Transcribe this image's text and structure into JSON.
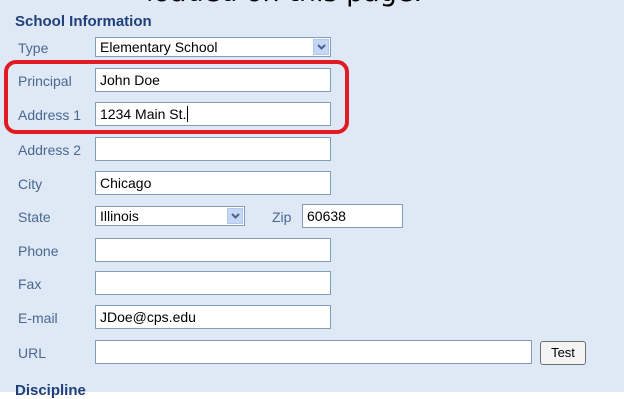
{
  "caption": "loaded on this page.",
  "section": {
    "title": "School Information",
    "next_title": "Discipline"
  },
  "fields": {
    "type": {
      "label": "Type",
      "value": "Elementary School"
    },
    "principal": {
      "label": "Principal",
      "value": "John Doe"
    },
    "address1": {
      "label": "Address 1",
      "value": "1234 Main St."
    },
    "address2": {
      "label": "Address 2",
      "value": ""
    },
    "city": {
      "label": "City",
      "value": "Chicago"
    },
    "state": {
      "label": "State",
      "value": "Illinois"
    },
    "zip": {
      "label": "Zip",
      "value": "60638"
    },
    "phone": {
      "label": "Phone",
      "value": ""
    },
    "fax": {
      "label": "Fax",
      "value": ""
    },
    "email": {
      "label": "E-mail",
      "value": "JDoe@cps.edu"
    },
    "url": {
      "label": "URL",
      "value": ""
    }
  },
  "buttons": {
    "test": "Test"
  },
  "colors": {
    "panel": "#dfe8f5",
    "label": "#4a6892",
    "heading": "#1f3f7a",
    "highlight": "#e11b22"
  }
}
